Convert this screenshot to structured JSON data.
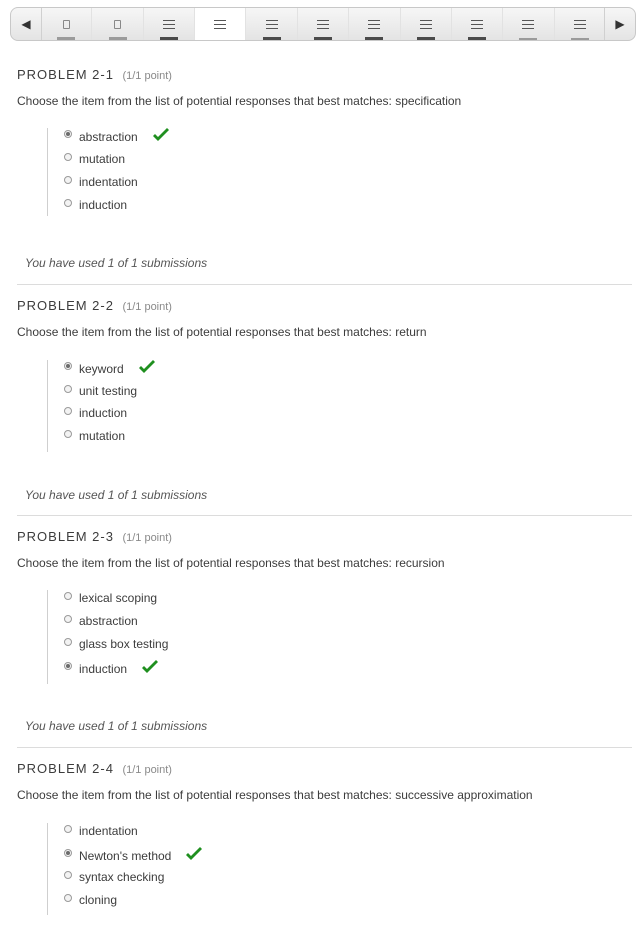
{
  "nav": {
    "prev_arrow": "◀",
    "next_arrow": "▶",
    "tabs": [
      {
        "icon": "doc-icon",
        "state": "visited"
      },
      {
        "icon": "doc-icon",
        "state": "visited"
      },
      {
        "icon": "list-icon",
        "state": "completed"
      },
      {
        "icon": "list-icon",
        "state": "active"
      },
      {
        "icon": "list-icon",
        "state": "completed"
      },
      {
        "icon": "list-icon",
        "state": "completed"
      },
      {
        "icon": "list-icon",
        "state": "completed"
      },
      {
        "icon": "list-icon",
        "state": "completed"
      },
      {
        "icon": "list-icon",
        "state": "completed"
      },
      {
        "icon": "list-icon",
        "state": "outline"
      },
      {
        "icon": "list-icon",
        "state": "outline"
      }
    ]
  },
  "problems": [
    {
      "title": "PROBLEM 2-1",
      "points": "(1/1 point)",
      "question": "Choose the item from the list of potential responses that best matches: specification",
      "choices": [
        {
          "label": "abstraction",
          "selected": true,
          "correct": true
        },
        {
          "label": "mutation",
          "selected": false,
          "correct": false
        },
        {
          "label": "indentation",
          "selected": false,
          "correct": false
        },
        {
          "label": "induction",
          "selected": false,
          "correct": false
        }
      ],
      "submissions": "You have used 1 of 1 submissions"
    },
    {
      "title": "PROBLEM 2-2",
      "points": "(1/1 point)",
      "question": "Choose the item from the list of potential responses that best matches: return",
      "choices": [
        {
          "label": "keyword",
          "selected": true,
          "correct": true
        },
        {
          "label": "unit testing",
          "selected": false,
          "correct": false
        },
        {
          "label": "induction",
          "selected": false,
          "correct": false
        },
        {
          "label": "mutation",
          "selected": false,
          "correct": false
        }
      ],
      "submissions": "You have used 1 of 1 submissions"
    },
    {
      "title": "PROBLEM 2-3",
      "points": "(1/1 point)",
      "question": "Choose the item from the list of potential responses that best matches: recursion",
      "choices": [
        {
          "label": "lexical scoping",
          "selected": false,
          "correct": false
        },
        {
          "label": "abstraction",
          "selected": false,
          "correct": false
        },
        {
          "label": "glass box testing",
          "selected": false,
          "correct": false
        },
        {
          "label": "induction",
          "selected": true,
          "correct": true
        }
      ],
      "submissions": "You have used 1 of 1 submissions"
    },
    {
      "title": "PROBLEM 2-4",
      "points": "(1/1 point)",
      "question": "Choose the item from the list of potential responses that best matches: successive approximation",
      "choices": [
        {
          "label": "indentation",
          "selected": false,
          "correct": false
        },
        {
          "label": "Newton's method",
          "selected": true,
          "correct": true
        },
        {
          "label": "syntax checking",
          "selected": false,
          "correct": false
        },
        {
          "label": "cloning",
          "selected": false,
          "correct": false
        }
      ]
    }
  ],
  "colors": {
    "correct_check": "#1f8f1f",
    "separator": "#dcdcdc"
  }
}
